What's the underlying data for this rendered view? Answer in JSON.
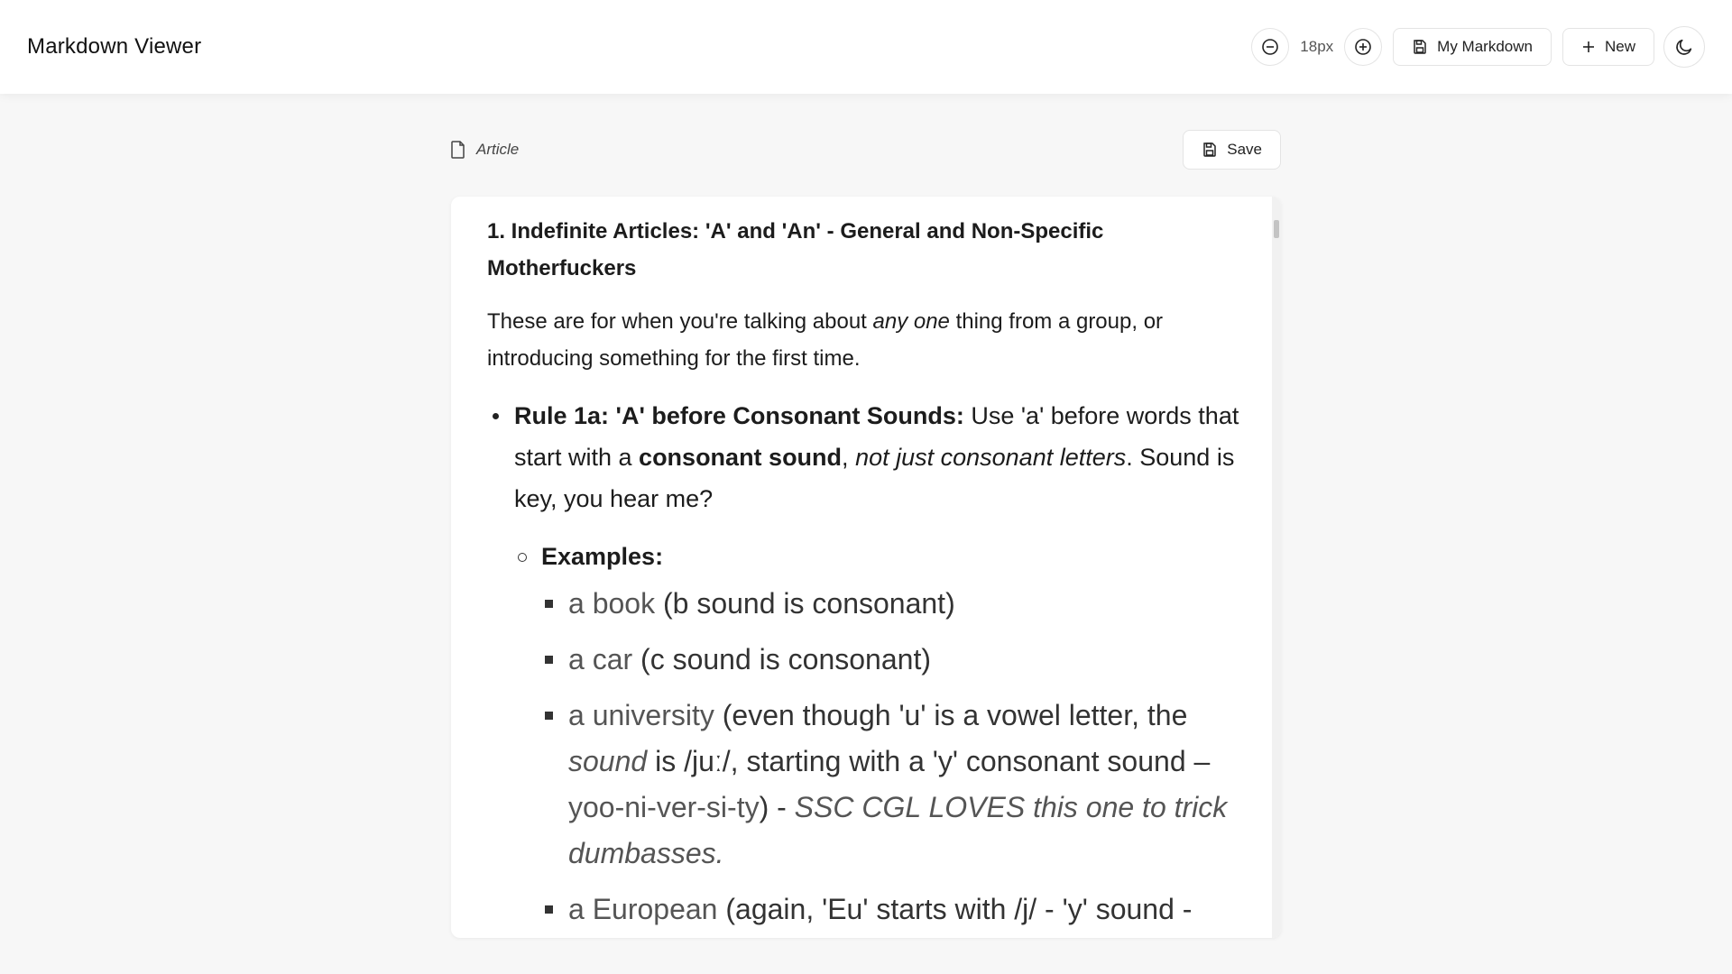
{
  "app": {
    "title": "Markdown Viewer"
  },
  "toolbar": {
    "font_size_label": "18px",
    "my_markdown_label": "My Markdown",
    "new_label": "New"
  },
  "document": {
    "name": "Article",
    "save_label": "Save"
  },
  "content": {
    "heading": "1. Indefinite Articles: 'A' and 'An' - General and Non-Specific Motherfuckers",
    "intro": {
      "before": "These are for when you're talking about ",
      "em": "any one",
      "after": " thing from a group, or introducing something for the first time."
    },
    "rule": {
      "title": "Rule 1a: 'A' before Consonant Sounds:",
      "t1": " Use 'a' before words that start with a ",
      "bold": "consonant sound",
      "t2": ", ",
      "em": "not just consonant letters",
      "t3": ". Sound is key, you hear me?"
    },
    "examples_label": "Examples:",
    "examples": [
      {
        "word": "a book",
        "note": " (b sound is consonant)"
      },
      {
        "word": "a car",
        "note": " (c sound is consonant)"
      },
      {
        "word": "a university",
        "note1": " (even though 'u' is a vowel letter, the ",
        "em": "sound",
        "note2": " is /juː/, starting with a 'y' consonant sound –",
        "syll": "yoo-ni-ver-si-ty",
        "note3": ") - ",
        "tip": "SSC CGL LOVES this one to trick dumbasses."
      },
      {
        "word": "a European",
        "note": " (again, 'Eu' starts with /j/ - 'y' sound -"
      }
    ]
  }
}
